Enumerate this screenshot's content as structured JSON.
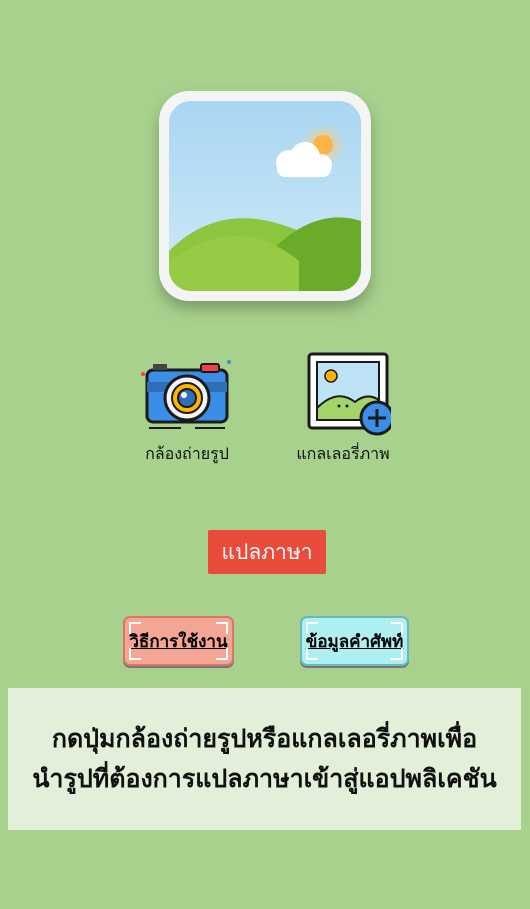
{
  "actions": {
    "camera_label": "กล้องถ่ายรูป",
    "gallery_label": "แกลเลอรี่ภาพ"
  },
  "translate_button": "แปลภาษา",
  "buttons": {
    "howto": "วิธีการใช้งาน",
    "vocab": "ข้อมูลคำศัพท์"
  },
  "help": {
    "line1": "กดปุ่มกล้องถ่ายรูปหรือแกลเลอรี่ภาพเพื่อ",
    "line2": "นำรูปที่ต้องการแปลภาษาเข้าสู่แอปพลิเคชัน"
  },
  "colors": {
    "background": "#a8d18d",
    "translate": "#e94b3c",
    "howto": "#f4a594",
    "vocab": "#aeeff2",
    "help_box": "#e2efd9"
  }
}
